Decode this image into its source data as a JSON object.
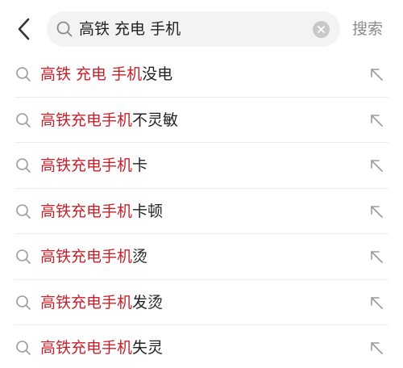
{
  "search": {
    "query": "高铁 充电 手机",
    "action_label": "搜索"
  },
  "icons": {
    "back": "chevron-left-icon",
    "search": "search-icon",
    "clear": "clear-icon",
    "fill": "arrow-up-left-icon"
  },
  "colors": {
    "highlight": "#c8202a",
    "text": "#222222",
    "muted": "#8a8a8a",
    "search_bg": "#f3f3f3"
  },
  "suggestions": [
    {
      "match": "高铁 充电 手机",
      "rest": "没电"
    },
    {
      "match": "高铁充电手机",
      "rest": "不灵敏"
    },
    {
      "match": "高铁充电手机",
      "rest": "卡"
    },
    {
      "match": "高铁充电手机",
      "rest": "卡顿"
    },
    {
      "match": "高铁充电手机",
      "rest": "烫"
    },
    {
      "match": "高铁充电手机",
      "rest": "发烫"
    },
    {
      "match": "高铁充电手机",
      "rest": "失灵"
    }
  ]
}
